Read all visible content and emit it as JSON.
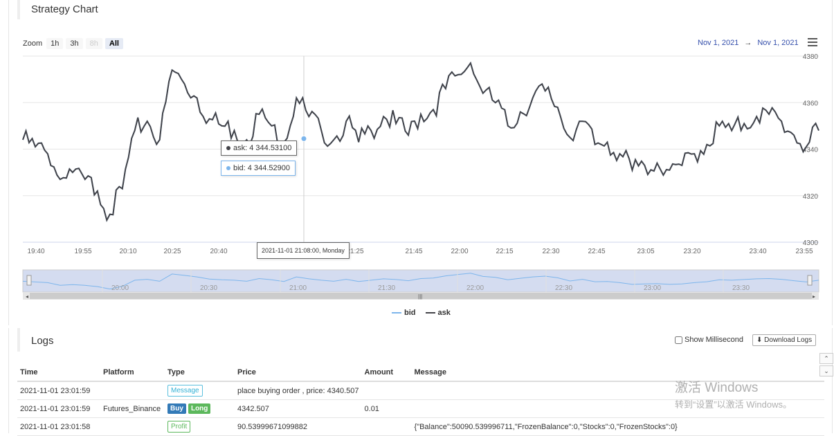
{
  "chart_panel": {
    "title": "Strategy Chart",
    "zoom_label": "Zoom",
    "zoom_buttons": [
      {
        "label": "1h",
        "state": "normal"
      },
      {
        "label": "3h",
        "state": "normal"
      },
      {
        "label": "8h",
        "state": "disabled"
      },
      {
        "label": "All",
        "state": "active"
      }
    ],
    "range_from": "Nov 1, 2021",
    "range_arrow": "→",
    "range_to": "Nov 1, 2021",
    "menu_icon": "hamburger-menu-icon"
  },
  "chart_data": {
    "type": "line",
    "x_tick_labels": [
      "19:40",
      "19:55",
      "20:10",
      "20:25",
      "20:40",
      "21:25",
      "21:45",
      "22:00",
      "22:15",
      "22:30",
      "22:45",
      "23:05",
      "23:20",
      "23:40",
      "23:55"
    ],
    "y_tick_labels": [
      "4380",
      "4360",
      "4340",
      "4320",
      "4300"
    ],
    "ylim": [
      4300,
      4380
    ],
    "navigator_labels": [
      "20:00",
      "20:30",
      "21:00",
      "21:30",
      "22:00",
      "22:30",
      "23:00",
      "23:30"
    ],
    "grid": true,
    "legend_position": "bottom-center",
    "series": [
      {
        "name": "bid",
        "color": "#7cb5ec",
        "values": [
          4344,
          4341,
          4338,
          4327,
          4330,
          4327,
          4322,
          4312,
          4323,
          4348,
          4352,
          4344,
          4374,
          4368,
          4362,
          4353,
          4350,
          4348,
          4344,
          4355,
          4350,
          4343,
          4362,
          4354,
          4348,
          4344,
          4352,
          4343,
          4348,
          4354,
          4351,
          4346,
          4355,
          4357,
          4366,
          4372,
          4377,
          4364,
          4360,
          4350,
          4356,
          4362,
          4365,
          4358,
          4345,
          4352,
          4342,
          4343,
          4338,
          4331,
          4333,
          4334,
          4331,
          4333,
          4338,
          4342,
          4350,
          4348,
          4351,
          4354,
          4355,
          4352,
          4346,
          4341,
          4348
        ]
      },
      {
        "name": "ask",
        "color": "#434348",
        "values": [
          4344,
          4341,
          4338,
          4327,
          4330,
          4327,
          4322,
          4312,
          4323,
          4348,
          4352,
          4344,
          4374,
          4368,
          4362,
          4353,
          4350,
          4348,
          4344,
          4355,
          4350,
          4343,
          4362,
          4354,
          4348,
          4344,
          4352,
          4343,
          4348,
          4354,
          4351,
          4346,
          4355,
          4357,
          4366,
          4372,
          4377,
          4364,
          4360,
          4350,
          4356,
          4362,
          4365,
          4358,
          4345,
          4352,
          4342,
          4343,
          4338,
          4331,
          4333,
          4334,
          4331,
          4333,
          4338,
          4342,
          4350,
          4348,
          4351,
          4354,
          4355,
          4352,
          4346,
          4341,
          4348
        ]
      }
    ],
    "hover_index": 21,
    "tooltip": {
      "ask_text": "ask: 4 344.53100",
      "bid_text": "bid: 4 344.52900",
      "time_text": "2021-11-01 21:08:00, Monday"
    }
  },
  "legend": [
    {
      "label": "bid",
      "color": "#7cb5ec"
    },
    {
      "label": "ask",
      "color": "#434348"
    }
  ],
  "logs_panel": {
    "title": "Logs",
    "show_millisecond_label": "Show Millisecond",
    "download_label": "Download Logs",
    "columns": [
      "Time",
      "Platform",
      "Type",
      "Price",
      "Amount",
      "Message"
    ],
    "rows": [
      {
        "time": "2021-11-01 23:01:59",
        "platform": "",
        "types": [
          {
            "label": "Message",
            "style": "info"
          }
        ],
        "price": "place buying order , price: 4340.507",
        "amount": "",
        "message": ""
      },
      {
        "time": "2021-11-01 23:01:59",
        "platform": "Futures_Binance",
        "types": [
          {
            "label": "Buy",
            "style": "primary"
          },
          {
            "label": "Long",
            "style": "success"
          }
        ],
        "price": "4342.507",
        "amount": "0.01",
        "message": ""
      },
      {
        "time": "2021-11-01 23:01:58",
        "platform": "",
        "types": [
          {
            "label": "Profit",
            "style": "outline-success"
          }
        ],
        "price": "90.53999671099882",
        "amount": "",
        "message": "{\"Balance\":50090.539996711,\"FrozenBalance\":0,\"Stocks\":0,\"FrozenStocks\":0}"
      }
    ]
  },
  "watermark": {
    "line1": "激活 Windows",
    "line2": "转到“设置”以激活 Windows。"
  },
  "side_buttons": {
    "up": "⌃",
    "down": "⌄"
  }
}
